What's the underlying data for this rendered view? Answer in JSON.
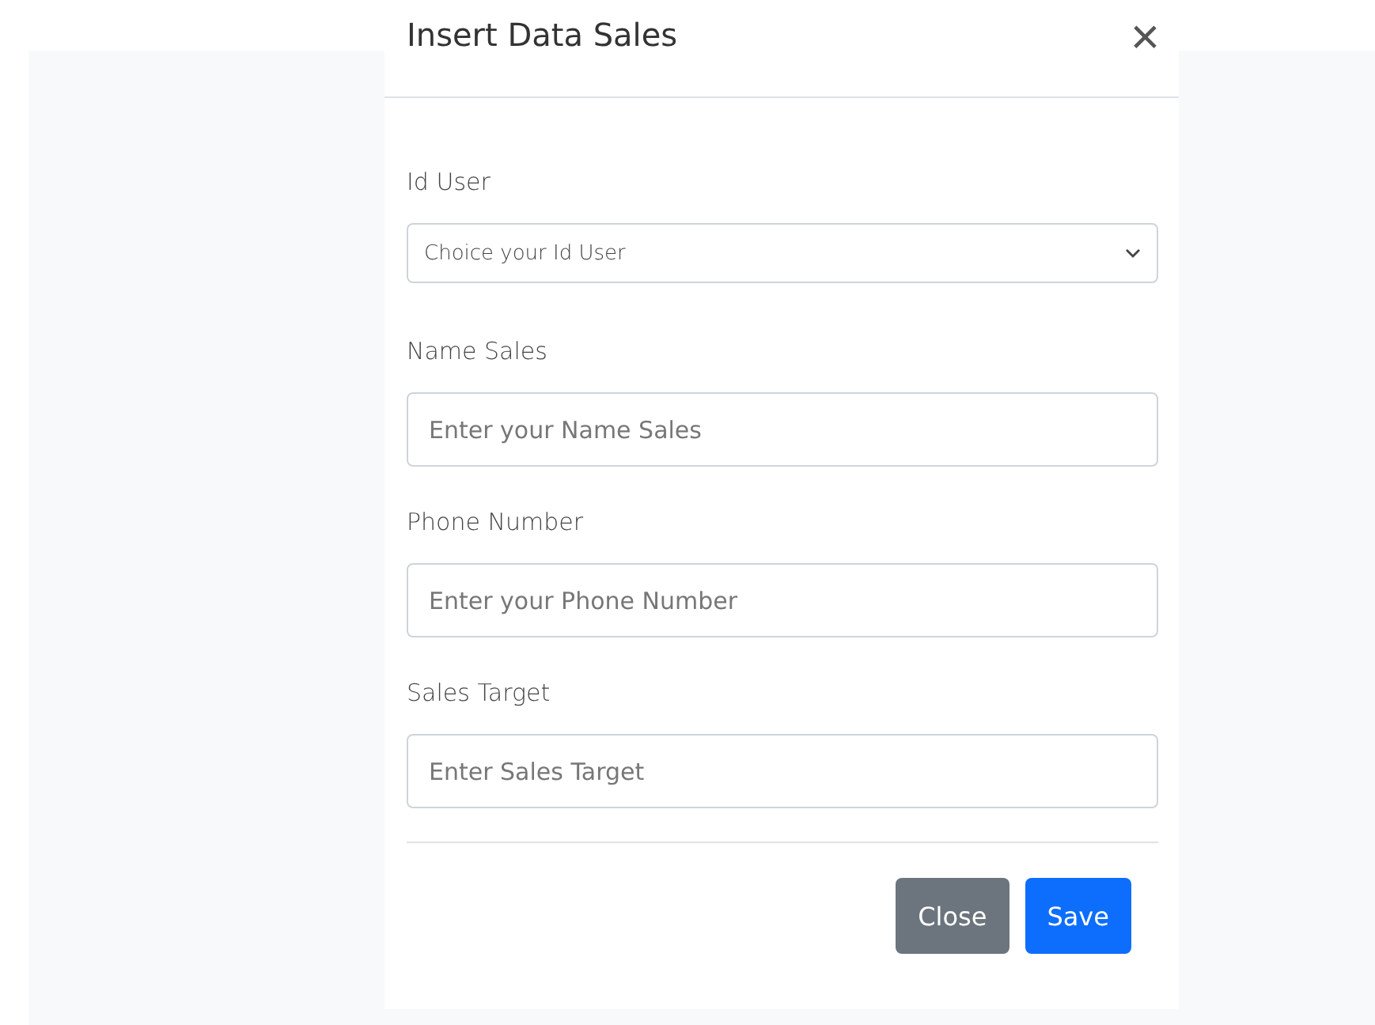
{
  "dialog": {
    "title": "Insert Data Sales",
    "close_icon": "×"
  },
  "fields": [
    {
      "kind": "select",
      "label": "Id User",
      "placeholder": "Choice your Id User"
    },
    {
      "kind": "input",
      "label": "Name Sales",
      "placeholder": "Enter your Name Sales"
    },
    {
      "kind": "input",
      "label": "Phone Number",
      "placeholder": "Enter your Phone Number"
    },
    {
      "kind": "input",
      "label": "Sales Target",
      "placeholder": "Enter Sales Target"
    }
  ],
  "buttons": [
    {
      "label": "Close",
      "kind": "secondary"
    },
    {
      "label": "Save",
      "kind": "primary"
    }
  ]
}
